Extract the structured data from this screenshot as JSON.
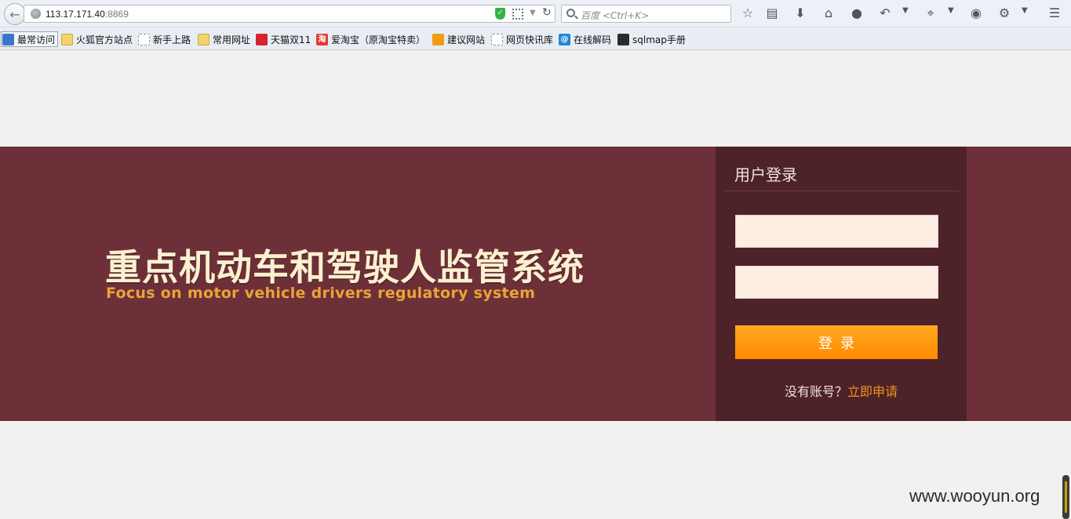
{
  "browser": {
    "url_host": "113.17.171.40",
    "url_port": ":8869",
    "search_placeholder": "百度 <Ctrl+K>",
    "icons": [
      "star-icon",
      "reading-list-icon",
      "download-icon",
      "home-icon",
      "chat-icon",
      "undo-icon",
      "crop-icon",
      "comment-icon",
      "tools-icon",
      "menu-icon"
    ]
  },
  "bookmarks": [
    {
      "label": "最常访问",
      "icon": "search"
    },
    {
      "label": "火狐官方站点",
      "icon": "folder"
    },
    {
      "label": "新手上路",
      "icon": "page"
    },
    {
      "label": "常用网址",
      "icon": "folder"
    },
    {
      "label": "天猫双11",
      "icon": "tmall"
    },
    {
      "label": "爱淘宝（原淘宝特卖）",
      "icon": "taobao"
    },
    {
      "label": "建议网站",
      "icon": "bulb"
    },
    {
      "label": "网页快讯库",
      "icon": "page"
    },
    {
      "label": "在线解码",
      "icon": "decode"
    },
    {
      "label": "sqlmap手册",
      "icon": "sqlmap"
    }
  ],
  "banner": {
    "title_cn": "重点机动车和驾驶人监管系统",
    "title_en": "Focus on motor vehicle drivers regulatory system"
  },
  "login": {
    "title": "用户登录",
    "button_label": "登录",
    "no_account_text": "没有账号？",
    "register_link": "立即申请"
  },
  "watermark": "www.wooyun.org",
  "colors": {
    "banner_bg": "#6e3038",
    "panel_bg": "#4d2228",
    "title_cn": "#fbf0cf",
    "title_en": "#e8a53a",
    "button": "#ff9a10",
    "link": "#f2931d"
  }
}
